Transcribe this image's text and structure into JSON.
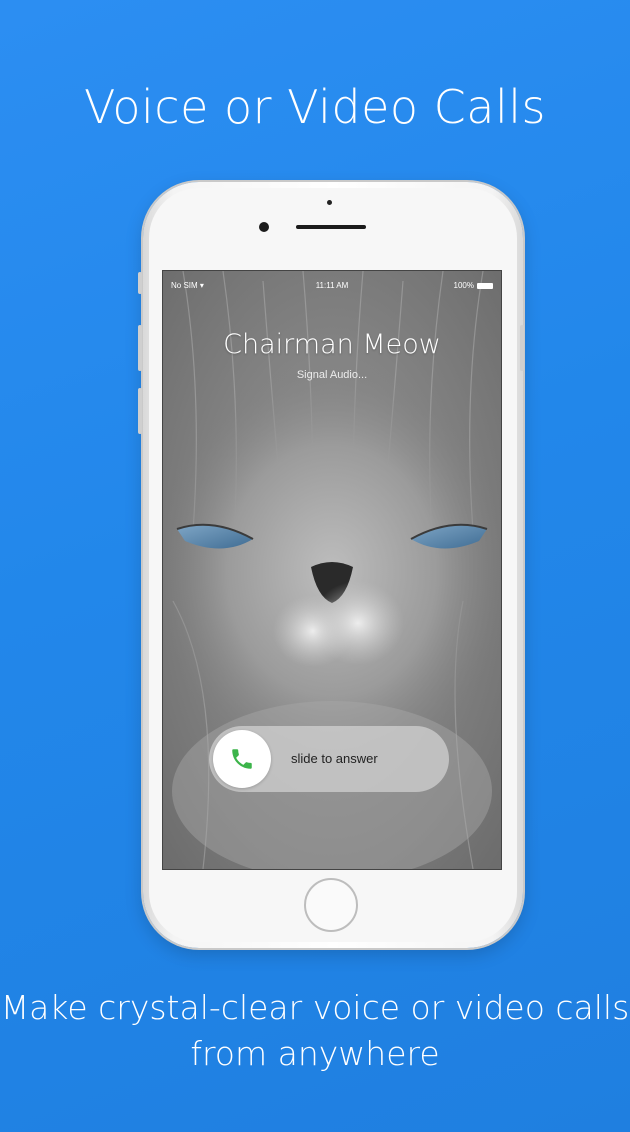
{
  "headline": "Voice or Video Calls",
  "description": "Make crystal-clear voice or video calls from anywhere",
  "status_bar": {
    "carrier": "No SIM",
    "time": "11:11 AM",
    "battery": "100%"
  },
  "call": {
    "caller_name": "Chairman Meow",
    "call_type": "Signal Audio..."
  },
  "answer_slider": {
    "label": "slide to answer"
  },
  "icons": {
    "wifi": "wifi-icon",
    "battery": "battery-icon",
    "phone": "phone-icon"
  },
  "colors": {
    "background": "#2287ea",
    "answer_green": "#3cb44a"
  }
}
